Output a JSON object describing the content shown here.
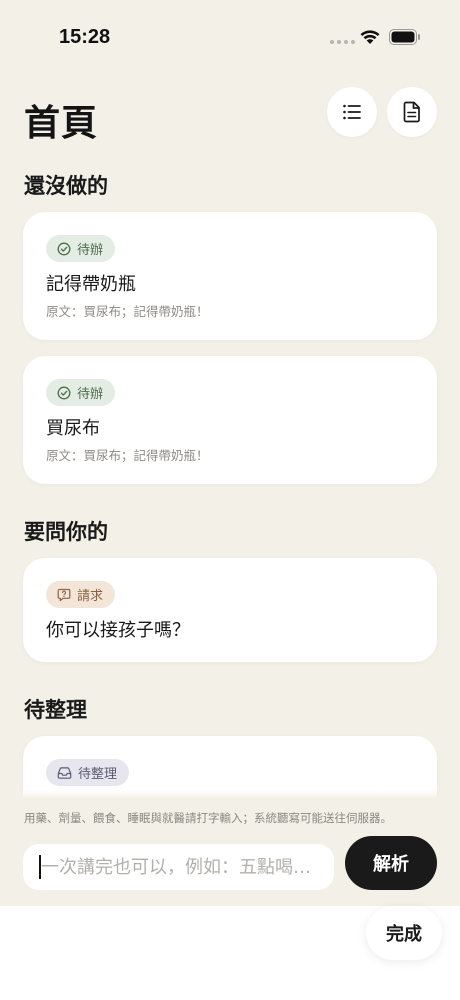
{
  "status_bar": {
    "time": "15:28"
  },
  "header": {
    "title": "首頁",
    "list_icon": "list-icon",
    "doc_icon": "document-icon"
  },
  "sections": {
    "todo_title": "還沒做的",
    "ask_title": "要問你的",
    "pending_title": "待整理"
  },
  "todo_cards": [
    {
      "tag": "待辦",
      "title": "記得帶奶瓶",
      "source": "原文：買尿布；記得帶奶瓶！"
    },
    {
      "tag": "待辦",
      "title": "買尿布",
      "source": "原文：買尿布；記得帶奶瓶！"
    }
  ],
  "ask_cards": [
    {
      "tag": "請求",
      "title": "你可以接孩子嗎？"
    }
  ],
  "pending_cards": [
    {
      "tag": "待整理"
    }
  ],
  "input": {
    "notice": "用藥、劑量、餵食、睡眠與就醫請打字輸入；系統聽寫可能送往伺服器。",
    "placeholder": "一次講完也可以，例如：五點喝…",
    "value": "",
    "parse_label": "解析"
  },
  "keyboard": {
    "done_label": "完成"
  },
  "colors": {
    "background": "#f3f0e7",
    "todo_tag_bg": "#e4ede3",
    "request_tag_bg": "#f3e6d8",
    "pending_tag_bg": "#e7e6ef",
    "primary_button": "#1a1a1a"
  }
}
